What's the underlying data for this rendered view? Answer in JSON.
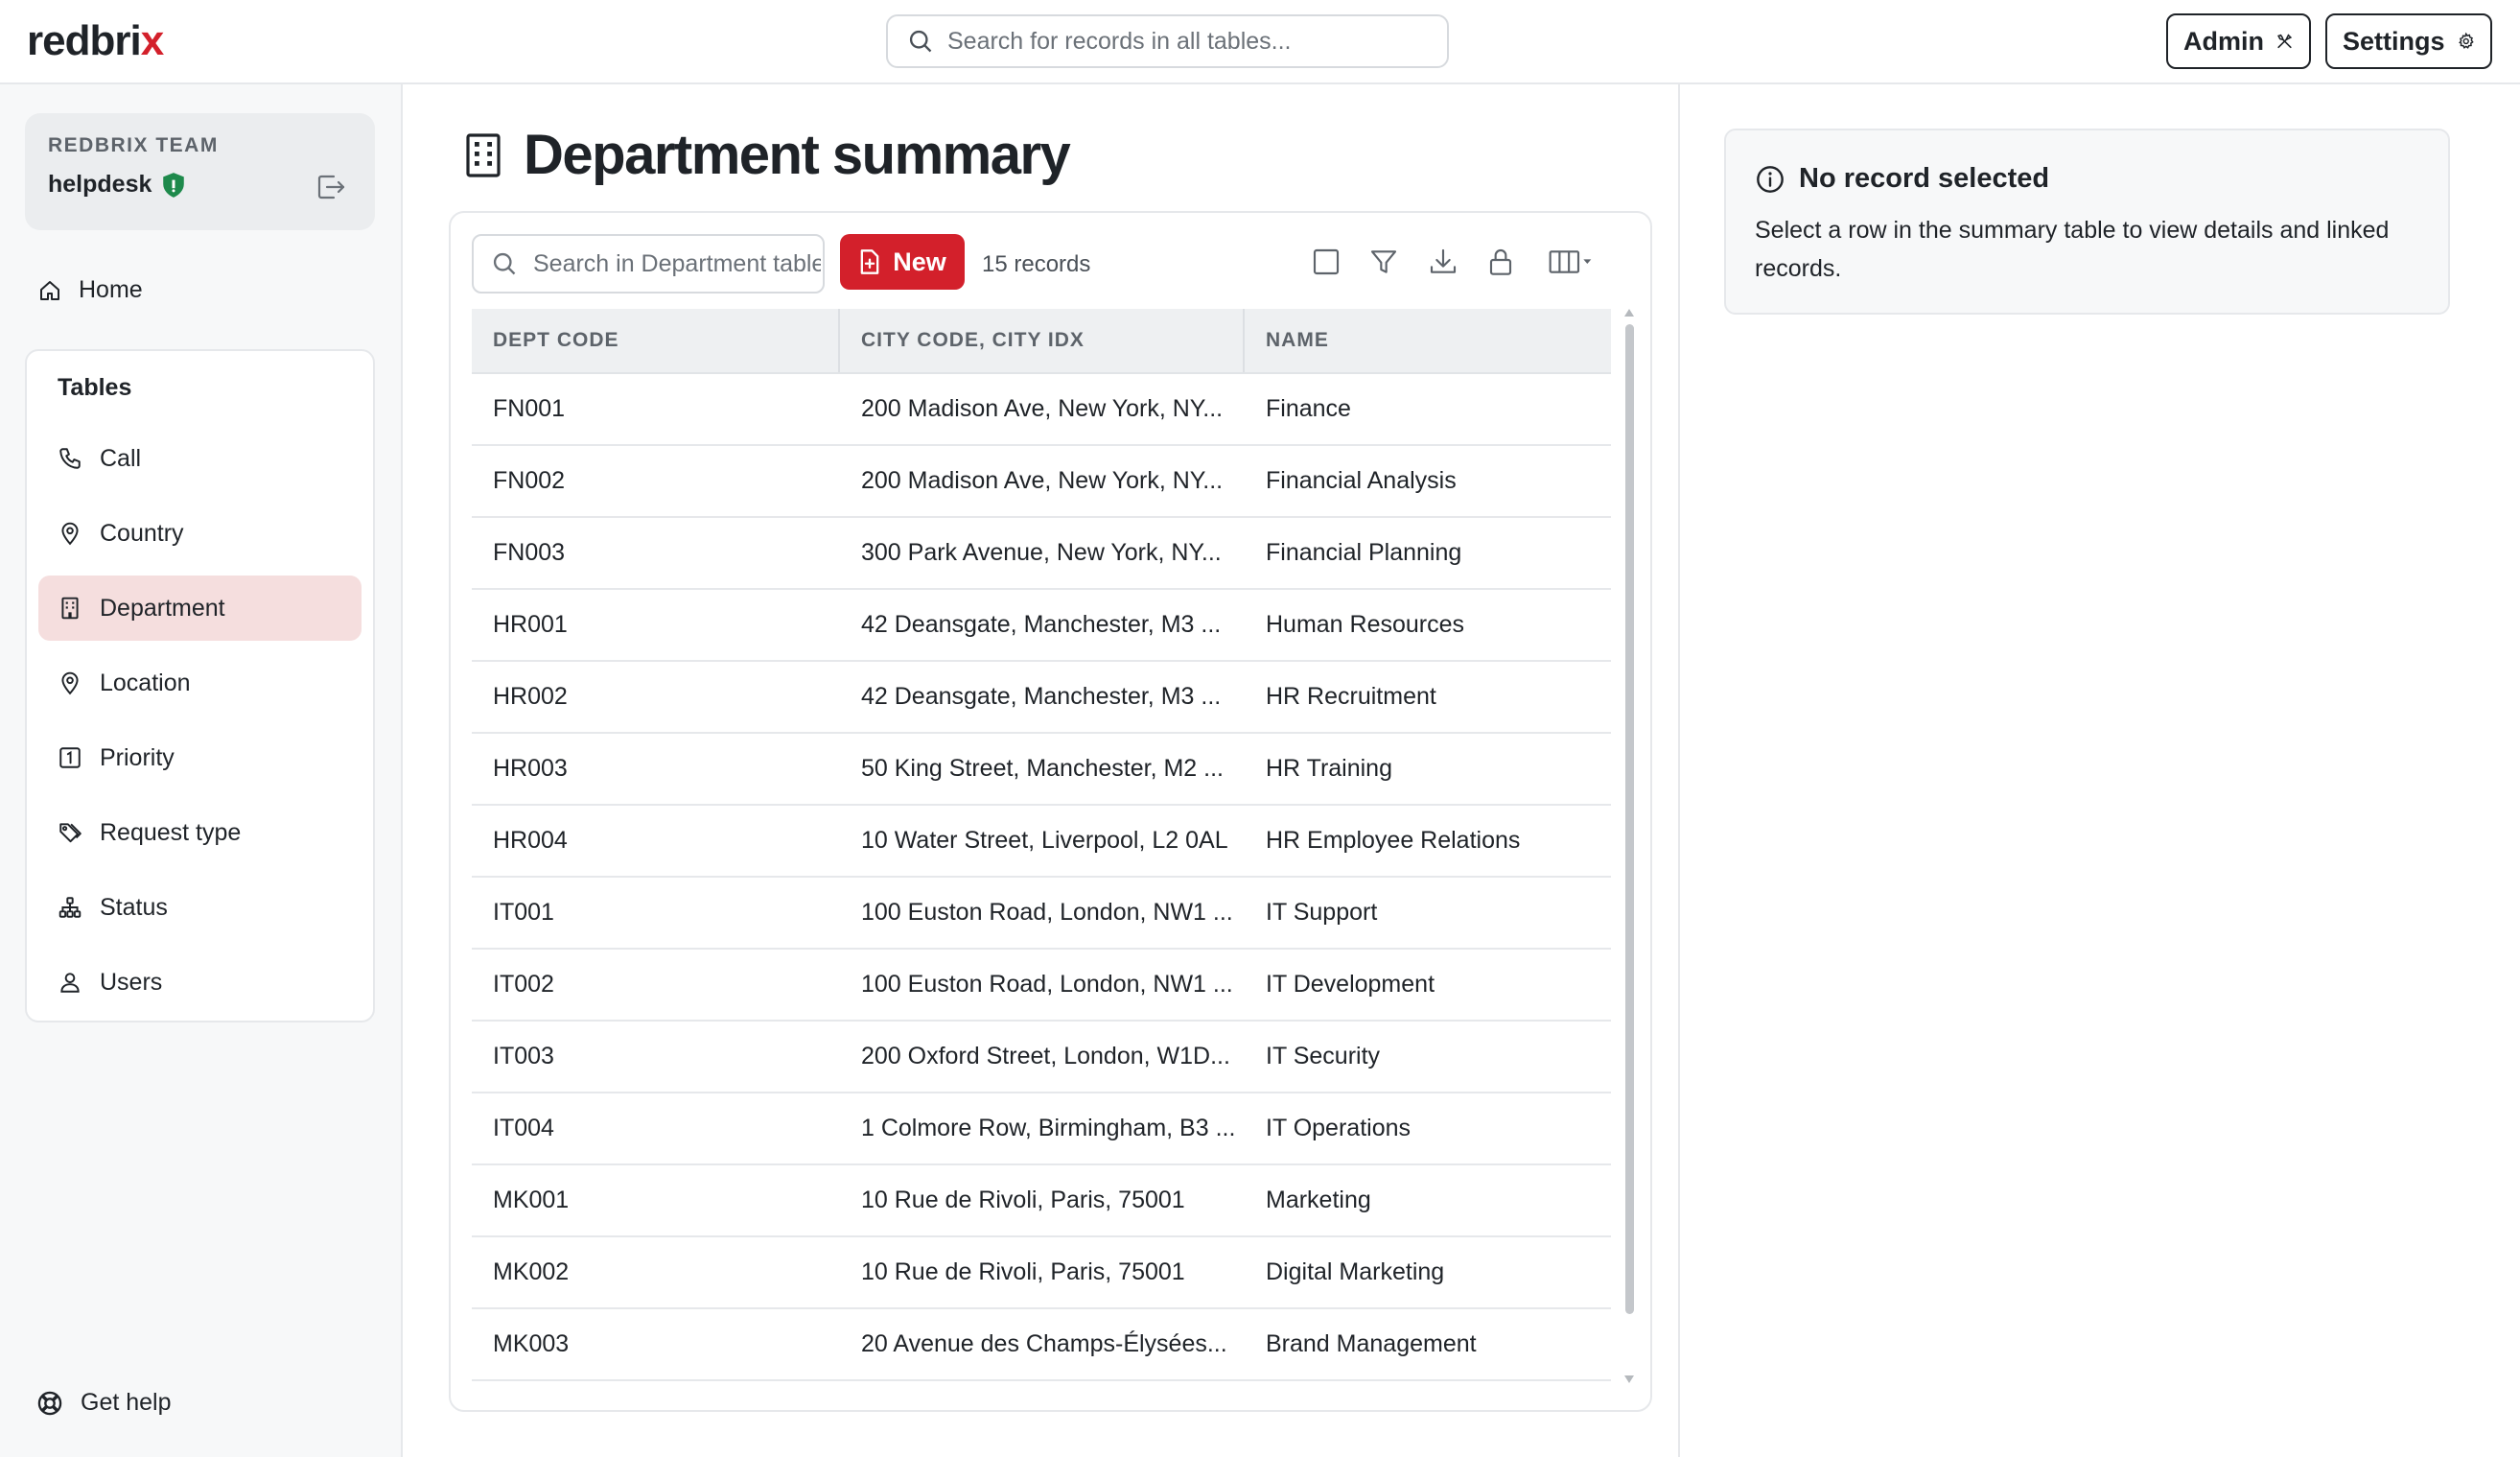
{
  "app": {
    "logo_main": "redbri",
    "logo_accent": "x",
    "search_placeholder": "Search for records in all tables...",
    "admin_label": "Admin",
    "settings_label": "Settings"
  },
  "sidebar": {
    "team_label": "REDBRIX TEAM",
    "team_name": "helpdesk",
    "home_label": "Home",
    "tables_title": "Tables",
    "items": [
      {
        "label": "Call",
        "icon": "phone-icon"
      },
      {
        "label": "Country",
        "icon": "map-pin-icon"
      },
      {
        "label": "Department",
        "icon": "building-icon",
        "active": true
      },
      {
        "label": "Location",
        "icon": "map-pin-icon"
      },
      {
        "label": "Priority",
        "icon": "number-one-icon"
      },
      {
        "label": "Request type",
        "icon": "tag-icon"
      },
      {
        "label": "Status",
        "icon": "hierarchy-icon"
      },
      {
        "label": "Users",
        "icon": "user-icon"
      }
    ],
    "help_label": "Get help"
  },
  "main": {
    "title": "Department summary",
    "search_placeholder": "Search in Department table",
    "new_label": "New",
    "record_count": "15 records",
    "columns": [
      "DEPT CODE",
      "CITY CODE, CITY IDX",
      "NAME"
    ],
    "rows": [
      [
        "FN001",
        "200 Madison Ave, New York, NY...",
        "Finance"
      ],
      [
        "FN002",
        "200 Madison Ave, New York, NY...",
        "Financial Analysis"
      ],
      [
        "FN003",
        "300 Park Avenue, New York, NY...",
        "Financial Planning"
      ],
      [
        "HR001",
        "42 Deansgate, Manchester, M3 ...",
        "Human Resources"
      ],
      [
        "HR002",
        "42 Deansgate, Manchester, M3 ...",
        "HR Recruitment"
      ],
      [
        "HR003",
        "50 King Street, Manchester, M2 ...",
        "HR Training"
      ],
      [
        "HR004",
        "10 Water Street, Liverpool, L2 0AL",
        "HR Employee Relations"
      ],
      [
        "IT001",
        "100 Euston Road, London, NW1 ...",
        "IT Support"
      ],
      [
        "IT002",
        "100 Euston Road, London, NW1 ...",
        "IT Development"
      ],
      [
        "IT003",
        "200 Oxford Street, London, W1D...",
        "IT Security"
      ],
      [
        "IT004",
        "1 Colmore Row, Birmingham, B3 ...",
        "IT Operations"
      ],
      [
        "MK001",
        "10 Rue de Rivoli, Paris, 75001",
        "Marketing"
      ],
      [
        "MK002",
        "10 Rue de Rivoli, Paris, 75001",
        "Digital Marketing"
      ],
      [
        "MK003",
        "20 Avenue des Champs-Élysées...",
        "Brand Management"
      ]
    ]
  },
  "detail": {
    "title": "No record selected",
    "text": "Select a row in the summary table to view details and linked records."
  },
  "colors": {
    "accent": "#d3202b",
    "active_nav_bg": "#f5dede",
    "shield": "#1e8a4c"
  }
}
